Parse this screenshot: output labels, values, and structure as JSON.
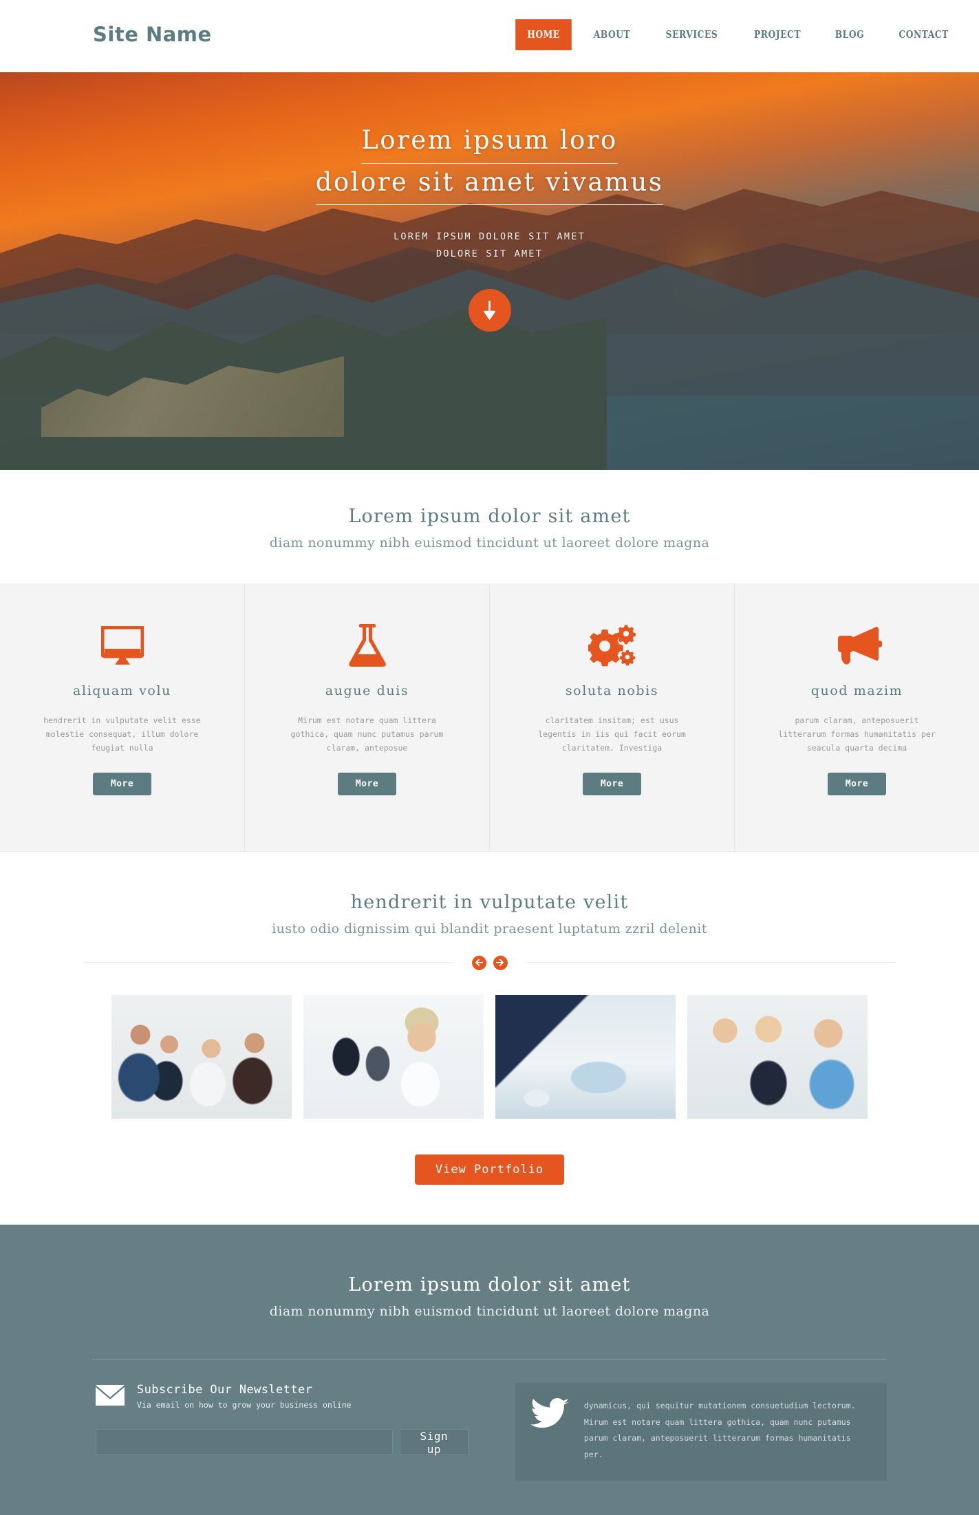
{
  "colors": {
    "accent": "#e4551f",
    "teal": "#5d7c81",
    "footer_bg": "#667f84",
    "feature_bg": "#f4f4f4"
  },
  "header": {
    "site_name": "Site Name",
    "nav": [
      {
        "label": "HOME",
        "active": true
      },
      {
        "label": "ABOUT",
        "active": false
      },
      {
        "label": "SERVICES",
        "active": false
      },
      {
        "label": "PROJECT",
        "active": false
      },
      {
        "label": "BLOG",
        "active": false
      },
      {
        "label": "CONTACT",
        "active": false
      }
    ]
  },
  "hero": {
    "title_line1": "Lorem ipsum loro",
    "title_line2": "dolore sit amet vivamus",
    "sub_line1": "LOREM IPSUM DOLORE SIT AMET",
    "sub_line2": "DOLORE SIT AMET",
    "scroll_icon": "arrow-down-icon"
  },
  "intro": {
    "title": "Lorem ipsum dolor sit amet",
    "subtitle": "diam nonummy nibh euismod tincidunt ut laoreet dolore magna"
  },
  "features": [
    {
      "icon": "monitor-icon",
      "title": "aliquam volu",
      "text": "hendrerit in vulputate velit esse molestie consequat, illum dolore feugiat nulla",
      "button": "More"
    },
    {
      "icon": "flask-icon",
      "title": "augue duis",
      "text": "Mirum est notare quam littera gothica, quam nunc putamus parum claram, anteposue",
      "button": "More"
    },
    {
      "icon": "gears-icon",
      "title": "soluta nobis",
      "text": "claritatem insitam; est usus legentis in iis qui facit eorum claritatem. Investiga",
      "button": "More"
    },
    {
      "icon": "megaphone-icon",
      "title": "quod mazim",
      "text": "parum claram, anteposuerit litterarum formas humanitatis per seacula quarta decima",
      "button": "More"
    }
  ],
  "portfolio": {
    "title": "hendrerit in vulputate velit",
    "subtitle": "iusto odio dignissim qui blandit praesent luptatum zzril delenit",
    "prev_icon": "arrow-left-circle-icon",
    "next_icon": "arrow-right-circle-icon",
    "thumbs": [
      {
        "alt": "business-team-photo"
      },
      {
        "alt": "smiling-businesswoman-photo"
      },
      {
        "alt": "meeting-documents-photo"
      },
      {
        "alt": "colleagues-discussion-photo"
      }
    ],
    "view_button": "View Portfolio"
  },
  "footer": {
    "title": "Lorem ipsum dolor sit amet",
    "subtitle": "diam nonummy nibh euismod tincidunt ut laoreet dolore magna",
    "newsletter": {
      "icon": "envelope-icon",
      "title": "Subscribe Our Newsletter",
      "subtitle": "Via email on how to grow your business online",
      "input_value": "",
      "input_placeholder": "",
      "button": "Sign up"
    },
    "twitter": {
      "icon": "twitter-bird-icon",
      "text": "dynamicus, qui sequitur mutationem consuetudium lectorum. Mirum est notare quam littera gothica, quam nunc putamus parum claram, anteposuerit litterarum formas humanitatis per."
    }
  }
}
